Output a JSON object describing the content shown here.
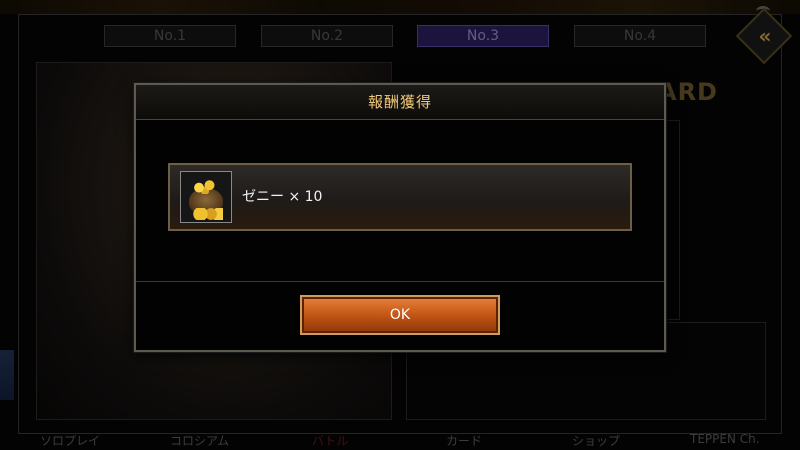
{
  "tabs": [
    {
      "label": "No.1",
      "active": false
    },
    {
      "label": "No.2",
      "active": false
    },
    {
      "label": "No.3",
      "active": true
    },
    {
      "label": "No.4",
      "active": false
    }
  ],
  "background": {
    "board_logo": "ARD"
  },
  "bottom_nav": [
    {
      "label": "ソロプレイ"
    },
    {
      "label": "コロシアム"
    },
    {
      "label": "バトル",
      "active": true
    },
    {
      "label": "カード"
    },
    {
      "label": "ショップ"
    },
    {
      "label": "TEPPEN Ch."
    }
  ],
  "dialog": {
    "title": "報酬獲得",
    "reward": {
      "icon": "zenny-bag-icon",
      "text": "ゼニー × 10"
    },
    "ok_label": "OK"
  },
  "colors": {
    "dialog_title": "#f0c77a",
    "ok_button": "#c75a18",
    "active_tab": "#2c1f5c"
  }
}
